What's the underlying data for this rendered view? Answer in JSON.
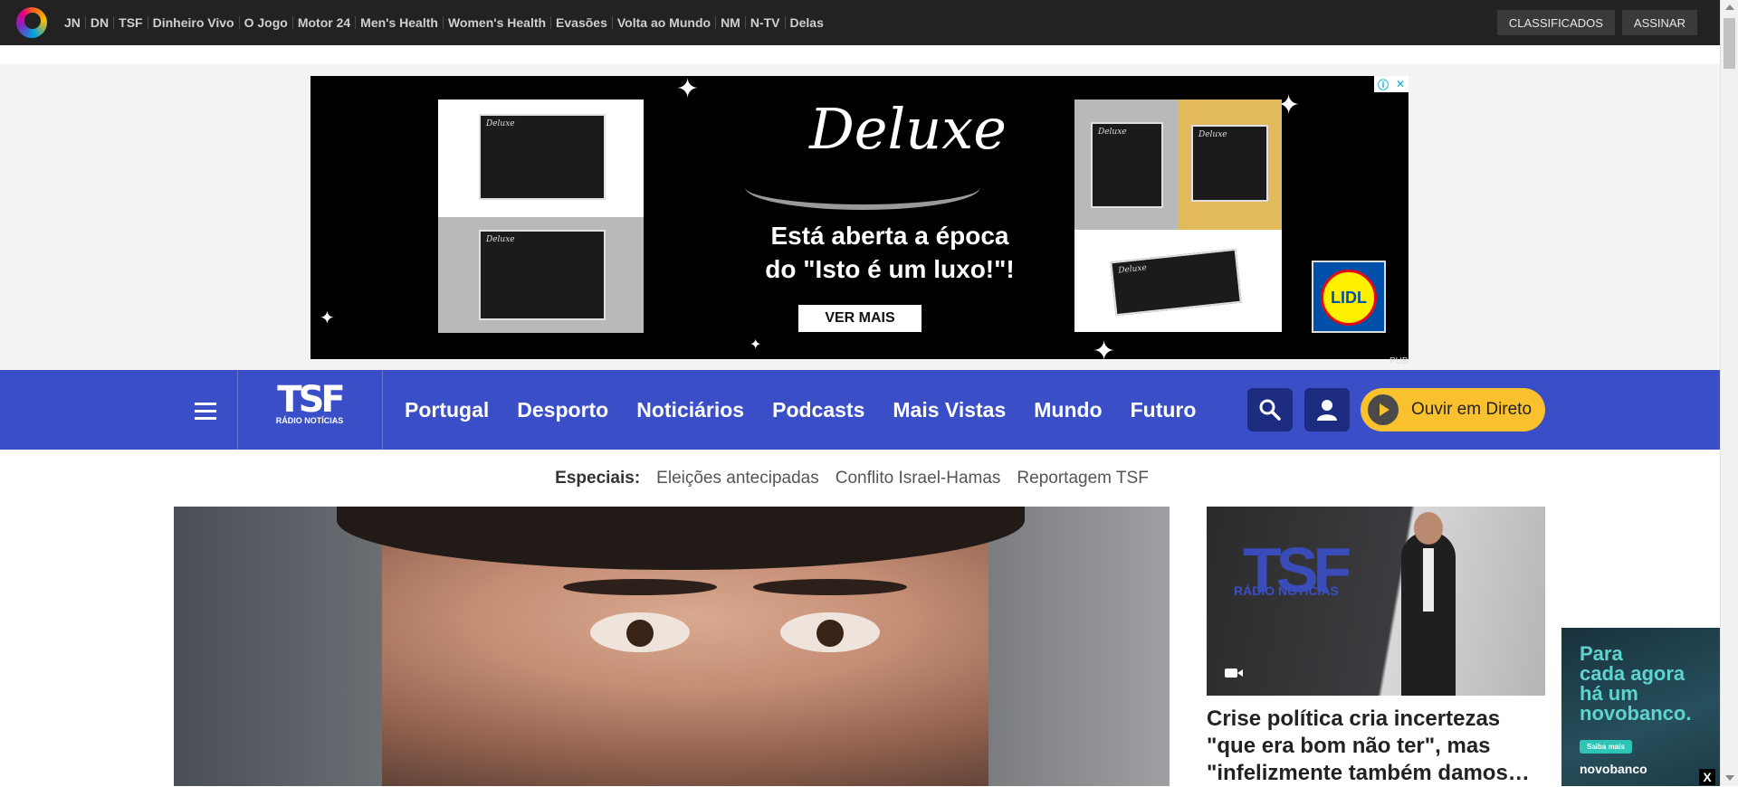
{
  "topbar": {
    "network_links": [
      "JN",
      "DN",
      "TSF",
      "Dinheiro Vivo",
      "O Jogo",
      "Motor 24",
      "Men's Health",
      "Women's Health",
      "Evasões",
      "Volta ao Mundo",
      "NM",
      "N-TV",
      "Delas"
    ],
    "classificados_label": "CLASSIFICADOS",
    "assinar_label": "ASSINAR"
  },
  "ad": {
    "brand": "Deluxe",
    "headline_line1": "Está aberta a época",
    "headline_line2": "do \"Isto é um luxo!\"!",
    "cta_label": "VER MAIS",
    "retailer": "LIDL",
    "pub_label": "PUB"
  },
  "mainnav": {
    "logo_text": "TSF",
    "logo_sub": "RÁDIO NOTÍCIAS",
    "links": [
      "Portugal",
      "Desporto",
      "Noticiários",
      "Podcasts",
      "Mais Vistas",
      "Mundo",
      "Futuro"
    ],
    "live_label": "Ouvir em Direto"
  },
  "specials": {
    "lead": "Especiais:",
    "items": [
      "Eleições antecipadas",
      "Conflito Israel-Hamas",
      "Reportagem TSF"
    ]
  },
  "side_story": {
    "title_line1": "Crise política cria incertezas",
    "title_line2": "\"que era bom não ter\", mas",
    "title_line3": "\"infelizmente também damos…"
  },
  "float_ad": {
    "text_line1": "Para",
    "text_line2": "cada agora",
    "text_line3": "há um",
    "text_line4": "novobanco.",
    "button_label": "Saiba mais",
    "brand": "novobanco",
    "close_label": "X"
  },
  "colors": {
    "nav_blue": "#3a4fc7",
    "live_yellow": "#f9c12e",
    "topbar_dark": "#222222"
  }
}
